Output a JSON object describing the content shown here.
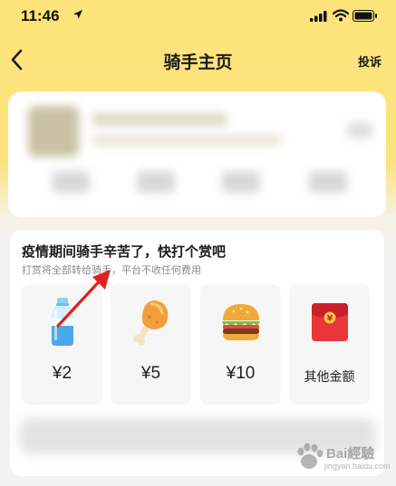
{
  "status_bar": {
    "time": "11:46",
    "location_icon": "location-arrow-icon",
    "signal_icon": "signal-icon",
    "wifi_icon": "wifi-icon",
    "battery_icon": "battery-icon"
  },
  "nav": {
    "title": "骑手主页",
    "complain_label": "投诉",
    "back_icon": "chevron-left-icon"
  },
  "tip": {
    "title": "疫情期间骑手辛苦了，快打个赏吧",
    "subtitle": "打赏将全部转给骑手，平台不收任何费用",
    "options": [
      {
        "label": "¥2",
        "icon": "water-bottle-icon"
      },
      {
        "label": "¥5",
        "icon": "chicken-leg-icon"
      },
      {
        "label": "¥10",
        "icon": "burger-icon"
      },
      {
        "label": "其他金额",
        "icon": "red-envelope-icon"
      }
    ]
  },
  "watermark": {
    "text": "Bai經驗",
    "url": "jingyan.baidu.com"
  },
  "colors": {
    "header_yellow": "#fde47a",
    "arrow_red": "#e0201e",
    "background": "#f2f2f2"
  }
}
